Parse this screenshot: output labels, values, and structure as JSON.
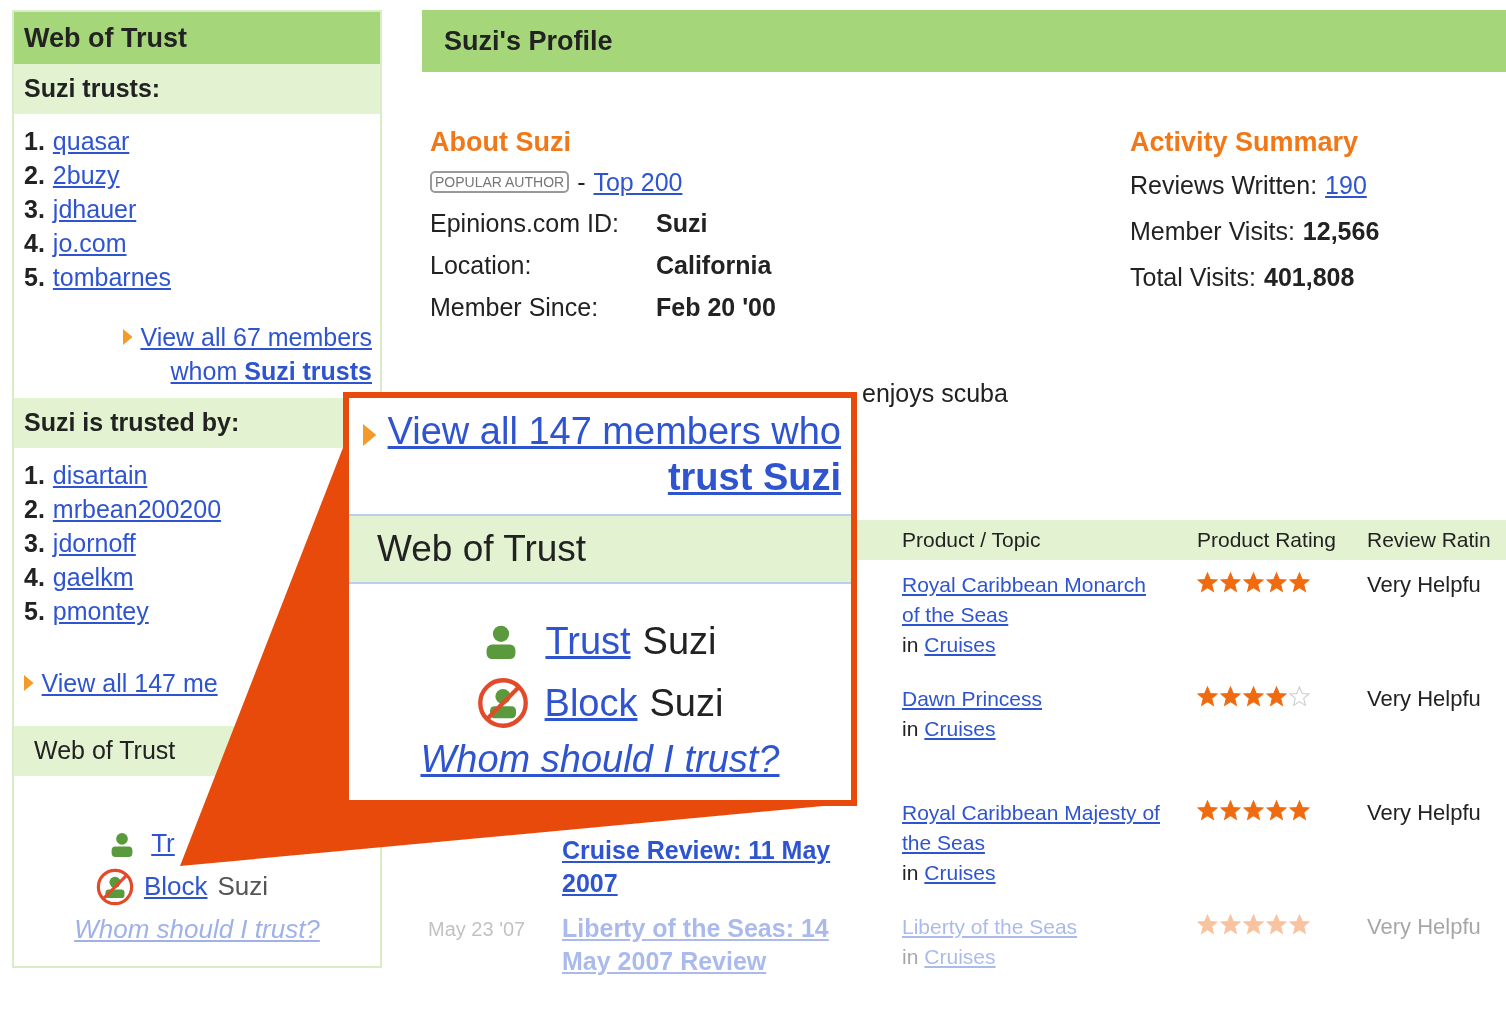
{
  "sidebar": {
    "title": "Web of Trust",
    "trusts": {
      "heading": "Suzi trusts:",
      "members": [
        {
          "rank": "1.",
          "name": "quasar"
        },
        {
          "rank": "2.",
          "name": "2buzy"
        },
        {
          "rank": "3.",
          "name": "jdhauer"
        },
        {
          "rank": "4.",
          "name": "jo.com"
        },
        {
          "rank": "5.",
          "name": "tombarnes"
        }
      ],
      "view_all": "View all 67 members",
      "view_all_2": "whom **Suzi trusts**"
    },
    "trusted_by": {
      "heading": "Suzi is trusted by:",
      "members": [
        {
          "rank": "1.",
          "name": "disartain"
        },
        {
          "rank": "2.",
          "name": "mrbean200200"
        },
        {
          "rank": "3.",
          "name": "jdornoff"
        },
        {
          "rank": "4.",
          "name": "gaelkm"
        },
        {
          "rank": "5.",
          "name": "pmontey"
        }
      ],
      "view_all": "View all 147 me"
    },
    "web_of_trust": {
      "heading": "Web of Trust",
      "trust_link": "Tr",
      "block_link": "Block",
      "block_suffix": "Suzi",
      "help_link": "Whom should I trust?"
    }
  },
  "profile": {
    "title": "Suzi's Profile",
    "about": {
      "heading": "About Suzi",
      "badge": "POPULAR AUTHOR",
      "separator": "-",
      "rank_link": "Top 200",
      "fields": [
        {
          "label": "Epinions.com ID:",
          "value": "Suzi"
        },
        {
          "label": "Location:",
          "value": "California"
        },
        {
          "label": "Member Since:",
          "value": "Feb 20 '00"
        }
      ]
    },
    "activity": {
      "heading": "Activity Summary",
      "stats": [
        {
          "label": "Reviews Written:",
          "value": "190",
          "kind": "link"
        },
        {
          "label": "Member Visits:",
          "value": "12,566",
          "kind": "bold"
        },
        {
          "label": "Total Visits:",
          "value": "401,808",
          "kind": "bold"
        }
      ]
    },
    "bio": "enjoys scuba",
    "reviews": {
      "columns": [
        "Product / Topic",
        "Product Rating",
        "Review Ratin"
      ],
      "rows": [
        {
          "product": "Royal Caribbean Monarch of the Seas",
          "in": "in",
          "category": "Cruises",
          "stars": 5,
          "review_rating": "Very Helpfu",
          "faded": false
        },
        {
          "product": "Dawn Princess",
          "in": "in",
          "category": "Cruises",
          "stars": 4,
          "review_rating": "Very Helpfu",
          "faded": false
        },
        {
          "title": "Cruise Review: 11 May 2007",
          "product": "Royal Caribbean Majesty of the Seas",
          "in": "in",
          "category": "Cruises",
          "stars": 5,
          "review_rating": "Very Helpfu",
          "faded": false
        },
        {
          "date": "May 23 '07",
          "title": "Liberty of the Seas: 14 May 2007 Review",
          "product": "Liberty of the Seas",
          "in": "in",
          "category": "Cruises",
          "stars": 5,
          "review_rating": "Very Helpfu",
          "faded": true
        }
      ]
    }
  },
  "callout": {
    "view_all": "View all 147 members who **trust Suzi**",
    "heading": "Web of Trust",
    "trust_link": "Trust",
    "trust_suffix": "Suzi",
    "block_link": "Block",
    "block_suffix": "Suzi",
    "help_link": "Whom should I trust?"
  }
}
